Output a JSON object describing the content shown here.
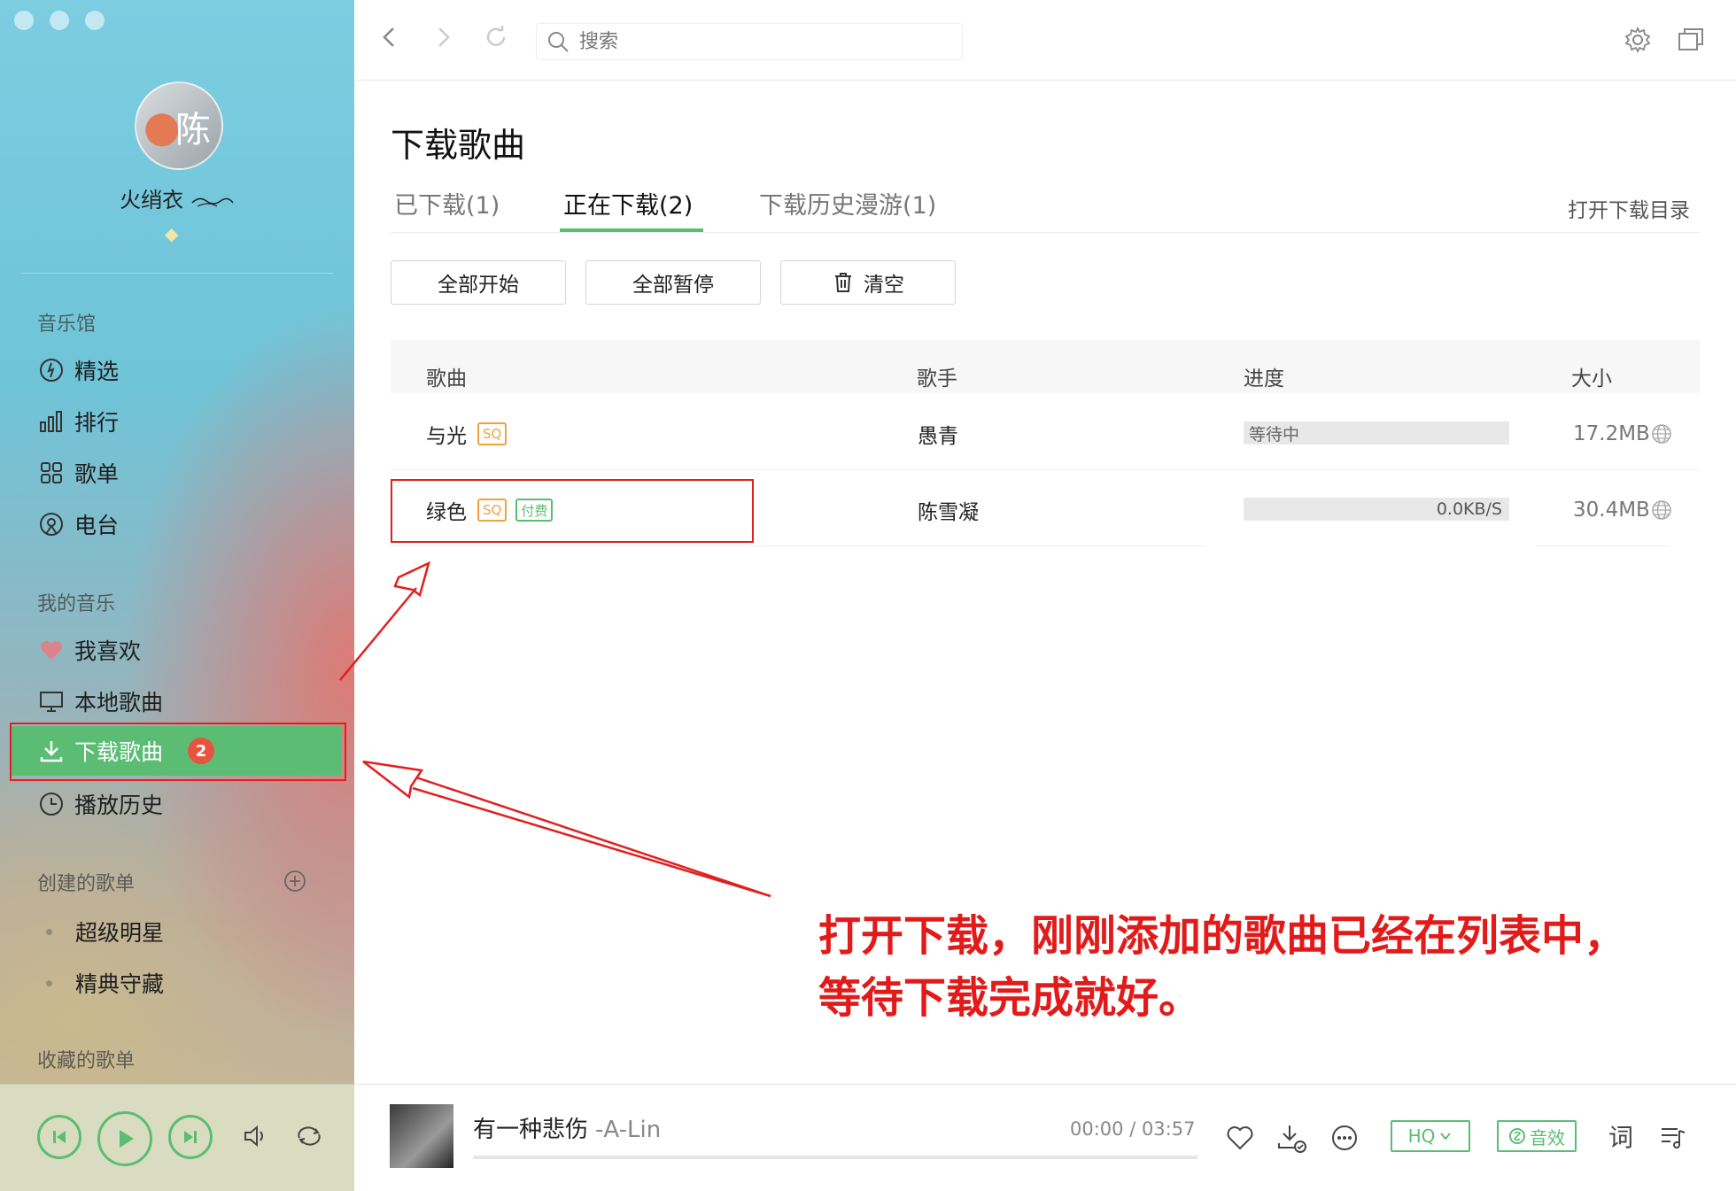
{
  "user": {
    "name": "火绡衣",
    "avatar_text": "陈"
  },
  "sidebar": {
    "section_music_hall": "音乐馆",
    "music_hall_items": [
      {
        "label": "精选",
        "icon": "featured-icon"
      },
      {
        "label": "排行",
        "icon": "ranking-icon"
      },
      {
        "label": "歌单",
        "icon": "playlist-grid-icon"
      },
      {
        "label": "电台",
        "icon": "radio-icon"
      }
    ],
    "section_my_music": "我的音乐",
    "my_music_items": [
      {
        "label": "我喜欢",
        "icon": "heart-icon"
      },
      {
        "label": "本地歌曲",
        "icon": "monitor-icon"
      },
      {
        "label": "下载歌曲",
        "icon": "download-icon",
        "badge": "2",
        "active": true
      },
      {
        "label": "播放历史",
        "icon": "clock-icon"
      }
    ],
    "section_created_playlists": "创建的歌单",
    "created_playlists": [
      "超级明星",
      "精典守藏"
    ],
    "section_collected_playlists": "收藏的歌单"
  },
  "topbar": {
    "search_placeholder": "搜索"
  },
  "page": {
    "title": "下载歌曲",
    "tabs": [
      {
        "label": "已下载(1)",
        "active": false
      },
      {
        "label": "正在下载(2)",
        "active": true
      },
      {
        "label": "下载历史漫游(1)",
        "active": false
      }
    ],
    "open_dir_label": "打开下载目录",
    "actions": {
      "start_all": "全部开始",
      "pause_all": "全部暂停",
      "clear": "清空"
    },
    "columns": {
      "song": "歌曲",
      "artist": "歌手",
      "progress": "进度",
      "size": "大小"
    },
    "rows": [
      {
        "song": "与光",
        "tags": [
          "SQ"
        ],
        "artist": "愚青",
        "progress_text": "等待中",
        "size": "17.2MB"
      },
      {
        "song": "绿色",
        "tags": [
          "SQ",
          "付费"
        ],
        "artist": "陈雪凝",
        "progress_text": "0.0KB/S",
        "size": "30.4MB"
      }
    ]
  },
  "annotation": {
    "line1": "打开下载，刚刚添加的歌曲已经在列表中，",
    "line2": "等待下载完成就好。"
  },
  "player": {
    "song": "有一种悲伤",
    "artist": "-A-Lin",
    "time": "00:00 / 03:57",
    "quality": "HQ",
    "effect": "音效",
    "lyrics": "词"
  },
  "colors": {
    "accent": "#5bbd74",
    "badge": "#e8533f",
    "annotation": "#e21a1a",
    "sq_tag": "#f0a33a"
  }
}
